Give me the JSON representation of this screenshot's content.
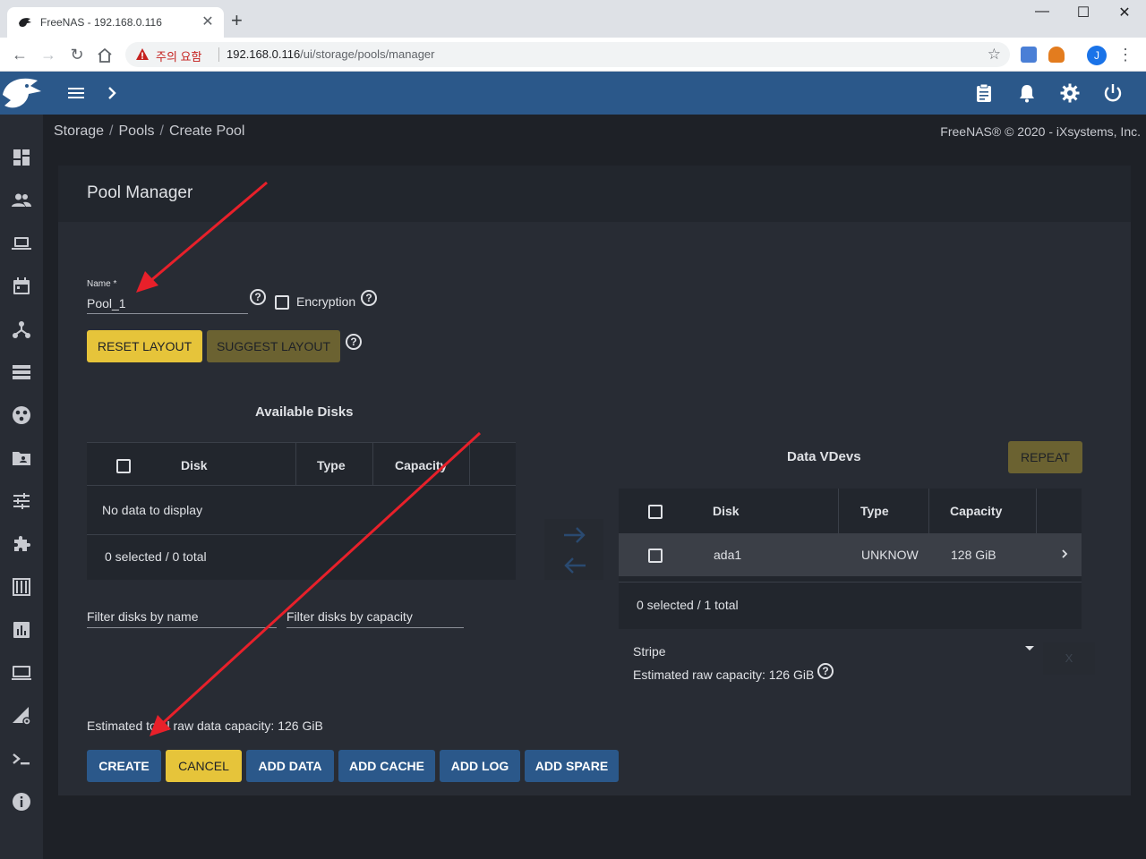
{
  "browser": {
    "tab_title": "FreeNAS - 192.168.0.116",
    "security_label": "주의 요함",
    "url_host": "192.168.0.116",
    "url_path": "/ui/storage/pools/manager",
    "avatar_letter": "J"
  },
  "breadcrumb": {
    "items": [
      "Storage",
      "Pools",
      "Create Pool"
    ]
  },
  "copyright": "FreeNAS® © 2020 - iXsystems, Inc.",
  "card": {
    "title": "Pool Manager"
  },
  "form": {
    "name_label": "Name *",
    "name_value": "Pool_1",
    "encryption_label": "Encryption",
    "reset_layout": "RESET LAYOUT",
    "suggest_layout": "SUGGEST LAYOUT"
  },
  "available_disks": {
    "title": "Available Disks",
    "columns": [
      "Disk",
      "Type",
      "Capacity"
    ],
    "empty_text": "No data to display",
    "footer": "0 selected / 0 total",
    "filter_name_placeholder": "Filter disks by name",
    "filter_capacity_placeholder": "Filter disks by capacity"
  },
  "data_vdevs": {
    "title": "Data VDevs",
    "repeat_label": "REPEAT",
    "columns": [
      "Disk",
      "Type",
      "Capacity"
    ],
    "rows": [
      {
        "disk": "ada1",
        "type": "UNKNOW",
        "capacity": "128 GiB"
      }
    ],
    "footer": "0 selected / 1 total",
    "layout": "Stripe",
    "remove_label": "X",
    "estimated_raw": "Estimated raw capacity: 126 GiB"
  },
  "estimated_total": "Estimated total raw data capacity: 126 GiB",
  "actions": {
    "create": "CREATE",
    "cancel": "CANCEL",
    "add_data": "ADD DATA",
    "add_cache": "ADD CACHE",
    "add_log": "ADD LOG",
    "add_spare": "ADD SPARE"
  },
  "colors": {
    "topbar": "#2b588a",
    "background": "#1e2127",
    "card": "#282c34",
    "accent_yellow": "#e6c43a",
    "annotation_arrow": "#e8202a"
  }
}
